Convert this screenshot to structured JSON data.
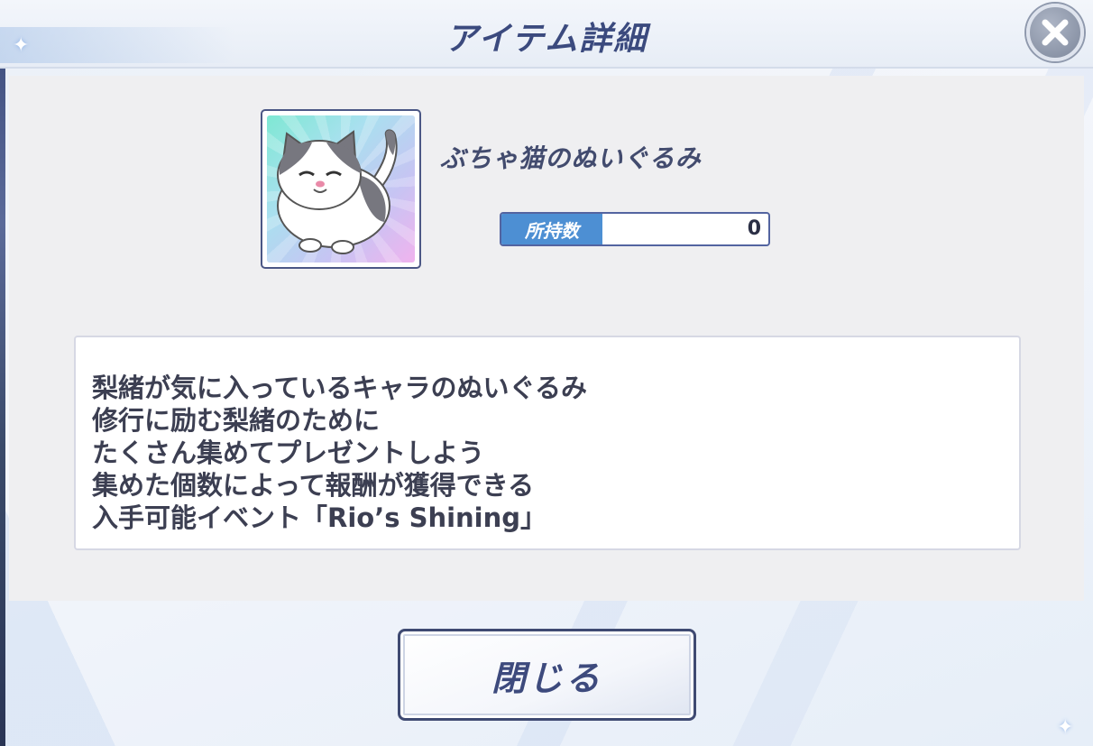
{
  "header": {
    "title": "アイテム詳細",
    "close_icon": "close-x-icon"
  },
  "item": {
    "name": "ぶちゃ猫のぬいぐるみ",
    "image": "cat-plush-icon",
    "owned_label": "所持数",
    "owned_value": "0"
  },
  "description": {
    "lines": [
      "梨緒が気に入っているキャラのぬいぐるみ",
      "修行に励む梨緒のために",
      "たくさん集めてプレゼントしよう",
      "集めた個数によって報酬が獲得できる",
      "入手可能イベント「Rio’s Shining」"
    ]
  },
  "footer": {
    "close_label": "閉じる"
  },
  "colors": {
    "title_text": "#3b4a7e",
    "owned_label_bg": "#4d8fd3",
    "button_border": "#3f4a72"
  }
}
